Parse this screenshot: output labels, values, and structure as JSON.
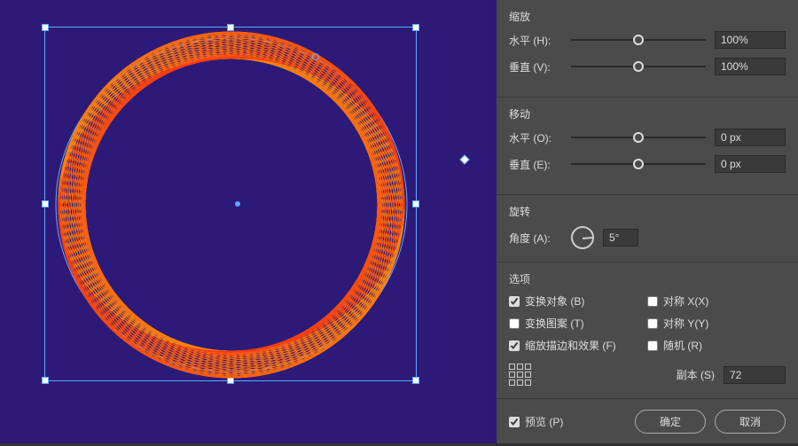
{
  "scale": {
    "title": "缩放",
    "h_label": "水平 (H):",
    "v_label": "垂直 (V):",
    "h_value": "100%",
    "v_value": "100%"
  },
  "move": {
    "title": "移动",
    "h_label": "水平 (O):",
    "v_label": "垂直 (E):",
    "h_value": "0 px",
    "v_value": "0 px"
  },
  "rotate": {
    "title": "旋转",
    "label": "角度 (A):",
    "value": "5°"
  },
  "options": {
    "title": "选项",
    "transform_object": "变换对象 (B)",
    "reflect_x": "对称 X(X)",
    "transform_pattern": "变换图案 (T)",
    "reflect_y": "对称 Y(Y)",
    "scale_strokes": "缩放描边和效果 (F)",
    "random": "随机 (R)",
    "copies_label": "副本 (S)",
    "copies_value": "72"
  },
  "footer": {
    "preview": "预览 (P)",
    "ok": "确定",
    "cancel": "取消"
  }
}
